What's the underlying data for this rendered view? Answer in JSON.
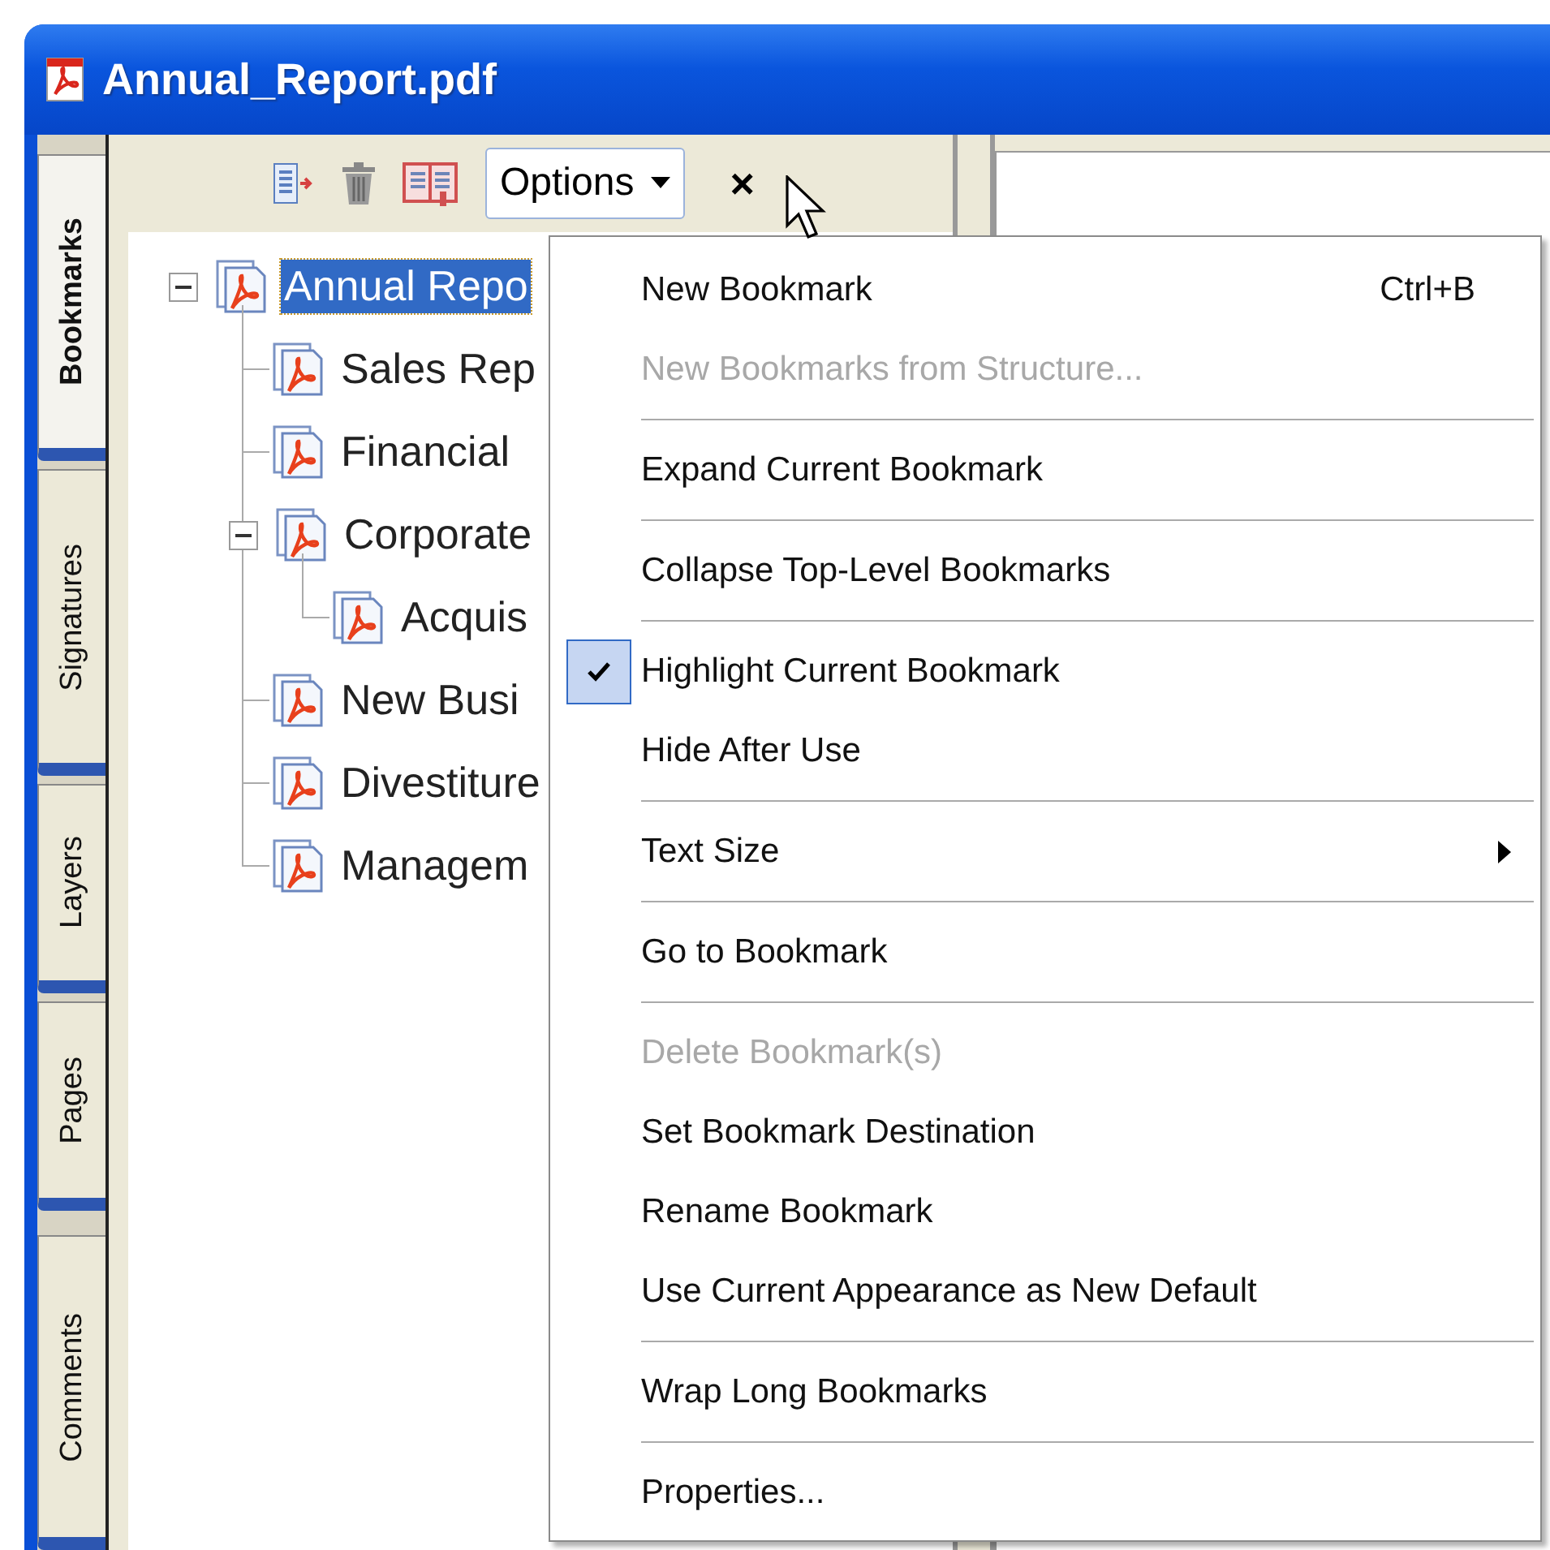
{
  "window": {
    "title": "Annual_Report.pdf"
  },
  "side_tabs": [
    {
      "label": "Bookmarks",
      "selected": true
    },
    {
      "label": "Signatures",
      "selected": false
    },
    {
      "label": "Layers",
      "selected": false
    },
    {
      "label": "Pages",
      "selected": false
    },
    {
      "label": "Comments",
      "selected": false
    }
  ],
  "toolbar": {
    "options_button": "Options",
    "close": "×"
  },
  "bookmarks": [
    {
      "label": "Annual Repo",
      "selected": true,
      "expanded": true,
      "children": [
        {
          "label": "Sales Rep",
          "selected": false
        },
        {
          "label": "Financial",
          "selected": false
        },
        {
          "label": "Corporate",
          "selected": false,
          "expanded": true,
          "children": [
            {
              "label": "Acquis",
              "selected": false
            }
          ]
        },
        {
          "label": "New Busi",
          "selected": false
        },
        {
          "label": "Divestiture",
          "selected": false
        },
        {
          "label": "Managem",
          "selected": false
        }
      ]
    }
  ],
  "menu": [
    {
      "kind": "item",
      "label": "New Bookmark",
      "shortcut": "Ctrl+B",
      "disabled": false,
      "checked": false,
      "submenu": false
    },
    {
      "kind": "item",
      "label": "New Bookmarks from Structure...",
      "disabled": true,
      "checked": false,
      "submenu": false
    },
    {
      "kind": "separator"
    },
    {
      "kind": "item",
      "label": "Expand Current Bookmark",
      "disabled": false,
      "checked": false,
      "submenu": false
    },
    {
      "kind": "separator"
    },
    {
      "kind": "item",
      "label": "Collapse Top-Level Bookmarks",
      "disabled": false,
      "checked": false,
      "submenu": false
    },
    {
      "kind": "separator"
    },
    {
      "kind": "item",
      "label": "Highlight Current Bookmark",
      "disabled": false,
      "checked": true,
      "submenu": false
    },
    {
      "kind": "item",
      "label": "Hide After Use",
      "disabled": false,
      "checked": false,
      "submenu": false
    },
    {
      "kind": "separator"
    },
    {
      "kind": "item",
      "label": "Text Size",
      "disabled": false,
      "checked": false,
      "submenu": true
    },
    {
      "kind": "separator"
    },
    {
      "kind": "item",
      "label": "Go to Bookmark",
      "disabled": false,
      "checked": false,
      "submenu": false
    },
    {
      "kind": "separator"
    },
    {
      "kind": "item",
      "label": "Delete Bookmark(s)",
      "disabled": true,
      "checked": false,
      "submenu": false
    },
    {
      "kind": "item",
      "label": "Set Bookmark Destination",
      "disabled": false,
      "checked": false,
      "submenu": false
    },
    {
      "kind": "item",
      "label": "Rename Bookmark",
      "disabled": false,
      "checked": false,
      "submenu": false
    },
    {
      "kind": "item",
      "label": "Use Current Appearance as New Default",
      "disabled": false,
      "checked": false,
      "submenu": false
    },
    {
      "kind": "separator"
    },
    {
      "kind": "item",
      "label": "Wrap Long Bookmarks",
      "disabled": false,
      "checked": false,
      "submenu": false
    },
    {
      "kind": "separator"
    },
    {
      "kind": "item",
      "label": "Properties...",
      "disabled": false,
      "checked": false,
      "submenu": false
    }
  ]
}
